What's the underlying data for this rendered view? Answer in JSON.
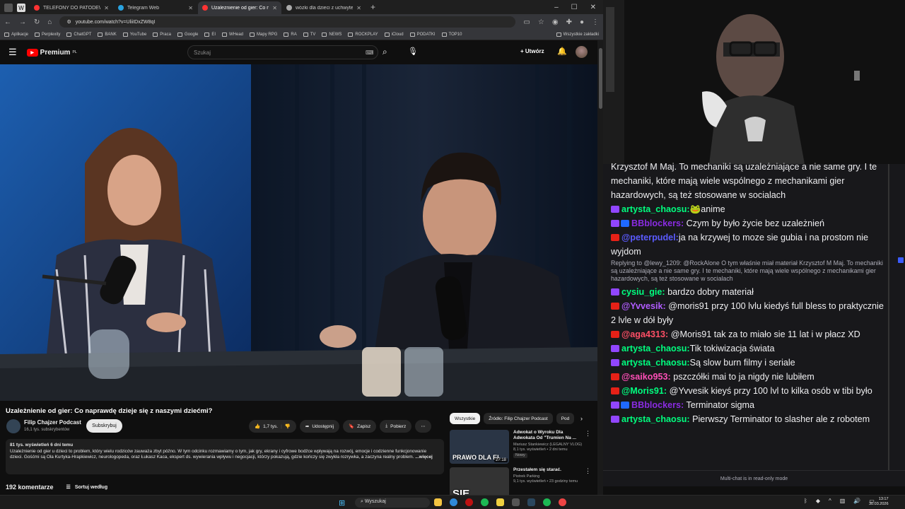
{
  "browser": {
    "tabs": [
      {
        "label": "TELEFONY DO PATODEWELOPE",
        "color": "#ff3333",
        "active": false
      },
      {
        "label": "Telegram Web",
        "color": "#2aa3e0",
        "active": false
      },
      {
        "label": "Uzależnienie od gier: Co napra",
        "color": "#ff3333",
        "active": true
      },
      {
        "label": "wózki dla dzieci z uchwytem ro",
        "color": "#aaaaaa",
        "active": false
      }
    ],
    "new_tab": "+",
    "url": "youtube.com/watch?v=UliiIDxZW8qI",
    "bookmarks": [
      "Aplikacje",
      "Perplexity",
      "ChatGPT",
      "BANK",
      "YouTube",
      "Praca",
      "Google",
      "EI",
      "WHead",
      "Mapy RPG",
      "RA",
      "TV",
      "NEWS",
      "ROCKPLAY",
      "iCloud",
      "PODATKI",
      "TOP10"
    ],
    "bookmarks_all": "Wszystkie zakładki"
  },
  "youtube": {
    "logo_text": "Premium",
    "logo_sup": "PL",
    "search_placeholder": "Szukaj",
    "create_label": "Utwórz",
    "video_title": "Uzależnienie od gier: Co naprawdę dzieje się z naszymi dziećmi?",
    "channel": "Filip Chajzer Podcast",
    "subscribers": "16,1 tys. subskrybentów",
    "subscribe_label": "Subskrybuj",
    "like_count": "1,7 tys.",
    "share_label": "Udostępnij",
    "save_label": "Zapisz",
    "download_label": "Pobierz",
    "desc_meta": "81 tys. wyświetleń  6 dni temu",
    "desc_text": "Uzależnienie od gier u dzieci to problem, który wielu rodziców zauważa zbyt późno. W tym odcinku rozmawiamy o tym, jak gry, ekrany i cyfrowe bodźce wpływają na rozwój, emocje i codzienne funkcjonowanie dzieci. Gośćmi są Ola Kurtyka-Hrapkiewicz, neurologopeda, oraz Łukasz Kaca, ekspert ds. wywierania wpływu i negocjacji, którzy pokazują, gdzie kończy się zwykła rozrywka, a zaczyna realny problem.",
    "desc_more": "...więcej",
    "comments_count": "192 komentarze",
    "sort_label": "Sortuj według",
    "chips": [
      "Wszystkie",
      "Źródło: Filip Chajzer Podcast",
      "Pod"
    ],
    "recommendations": [
      {
        "title": "Adwokat o Wyroku Dla Adwokata Od \"Trumien Na ...",
        "channel": "Mariusz Stankiewicz (LEGALNY VLOG)",
        "meta": "8,1 tys. wyświetleń • 2 dni temu",
        "badge": "Nowy",
        "duration": "27:18",
        "thumb_text": "PRAWO DLA EL"
      },
      {
        "title": "Przestałem się starać.",
        "channel": "Piotrek Parking",
        "meta": "9,1 tys. wyświetleń • 23 godziny temu",
        "badge": "",
        "duration": "",
        "thumb_text": "SIĘ"
      }
    ]
  },
  "chat": {
    "messages": [
      {
        "platform": "",
        "mod": false,
        "user": "",
        "color": "#efeff1",
        "text": "Krzysztof M Maj. To mechaniki są uzależniające a nie same gry. I te mechaniki, które mają wiele wspólnego z mechanikami gier hazardowych, są też stosowane w socialach",
        "reply": ""
      },
      {
        "platform": "tw",
        "mod": false,
        "user": "artysta_chaosu:",
        "color": "#00ff7f",
        "text": "🐸anime",
        "reply": ""
      },
      {
        "platform": "tw",
        "mod": true,
        "user": "BBblockers:",
        "color": "#8a2be2",
        "text": " Czym by było życie bez uzależnień",
        "reply": ""
      },
      {
        "platform": "yt",
        "mod": false,
        "user": "@peterpudel:",
        "color": "#5b5bff",
        "text": "ja na krzywej to moze sie gubia i na prostom nie wyjdom",
        "reply": "Replying to @lewy_1209: @RockAlone O tym właśnie miał materiał Krzysztof M Maj. To mechaniki są uzależniające a nie same gry. I te mechaniki, które mają wiele wspólnego z mechanikami gier hazardowych, są też stosowane w socialach"
      },
      {
        "platform": "tw",
        "mod": false,
        "user": "cysiu_gie:",
        "color": "#00ff7f",
        "text": "  bardzo dobry materiał",
        "reply": ""
      },
      {
        "platform": "yt",
        "mod": false,
        "user": "@Yvvesik:",
        "color": "#b05cff",
        "text": " @moris91 przy 100 lvlu kiedyś full bless to praktycznie 2 lvle w dół były",
        "reply": ""
      },
      {
        "platform": "yt",
        "mod": false,
        "user": "@aga4313:",
        "color": "#ff4f66",
        "text": " @Moris91 tak za to miało sie 11 lat i w płacz XD",
        "reply": ""
      },
      {
        "platform": "tw",
        "mod": false,
        "user": "artysta_chaosu:",
        "color": "#00ff7f",
        "text": "Tik tokiwizacja świata",
        "reply": ""
      },
      {
        "platform": "tw",
        "mod": false,
        "user": "artysta_chaosu:",
        "color": "#00ff7f",
        "text": "Są slow burn filmy i seriale",
        "reply": ""
      },
      {
        "platform": "yt",
        "mod": false,
        "user": "@saiko953:",
        "color": "#ff4fb8",
        "text": " pszczółki mai to ja nigdy nie lubiłem",
        "reply": ""
      },
      {
        "platform": "yt",
        "mod": false,
        "user": "@Moris91:",
        "color": "#00ff7f",
        "text": " @Yvvesik kieyś przy 100 lvl to kilka osób w tibi było",
        "reply": ""
      },
      {
        "platform": "tw",
        "mod": true,
        "user": "BBblockers:",
        "color": "#8a2be2",
        "text": " Terminator sigma",
        "reply": ""
      },
      {
        "platform": "tw",
        "mod": false,
        "user": "artysta_chaosu:",
        "color": "#00ff7f",
        "text": " Pierwszy Terminator to slasher ale z robotem",
        "reply": ""
      }
    ],
    "footer": "Multi-chat is in read-only mode"
  },
  "taskbar": {
    "search_label": "Wyszukaj",
    "time": "13:17",
    "date": "30.03.2026"
  }
}
